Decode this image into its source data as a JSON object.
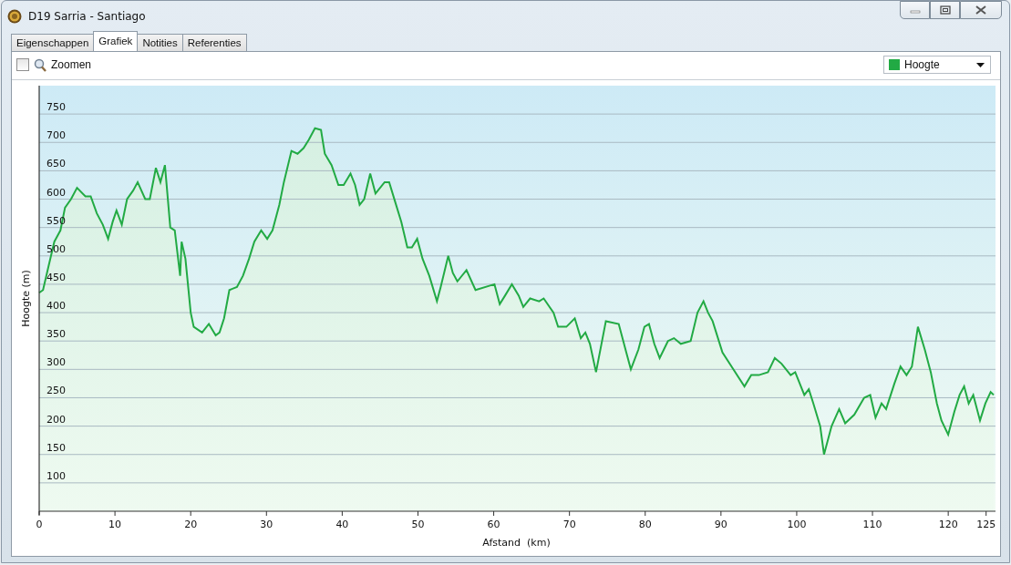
{
  "window": {
    "title": "D19 Sarria - Santiago"
  },
  "tabs": [
    {
      "label": "Eigenschappen",
      "selected": false
    },
    {
      "label": "Grafiek",
      "selected": true
    },
    {
      "label": "Notities",
      "selected": false
    },
    {
      "label": "Referenties",
      "selected": false
    }
  ],
  "toolbar": {
    "zoom_checkbox": {
      "label": "Zoomen",
      "checked": false
    }
  },
  "chart_data": {
    "type": "area",
    "xlabel": "Afstand  (km)",
    "ylabel": "Hoogte (m)",
    "x": [
      0,
      0.5,
      1.2,
      2.0,
      2.8,
      3.4,
      4.2,
      5.0,
      6.1,
      6.8,
      7.6,
      8.4,
      9.1,
      9.7,
      10.2,
      10.9,
      11.6,
      12.4,
      13.0,
      14.0,
      14.6,
      15.4,
      16.0,
      16.6,
      17.3,
      17.9,
      18.6,
      18.8,
      19.3,
      20.0,
      20.4,
      21.5,
      22.4,
      23.3,
      23.8,
      24.4,
      25.1,
      26.1,
      26.9,
      27.7,
      28.4,
      29.3,
      30.1,
      30.8,
      31.7,
      32.3,
      33.3,
      34.1,
      34.9,
      35.6,
      36.4,
      37.2,
      37.7,
      38.6,
      39.5,
      40.2,
      41.1,
      41.7,
      42.3,
      42.9,
      43.7,
      44.4,
      45.6,
      46.2,
      47.0,
      47.8,
      48.6,
      49.2,
      49.9,
      50.6,
      51.5,
      52.5,
      53.0,
      54.0,
      54.6,
      55.2,
      56.4,
      57.6,
      60.1,
      60.8,
      61.5,
      62.4,
      63.3,
      63.9,
      64.8,
      66.0,
      66.6,
      67.9,
      68.5,
      69.6,
      70.7,
      71.5,
      72.1,
      72.7,
      73.5,
      74.8,
      76.5,
      77.5,
      78.1,
      79.1,
      79.9,
      80.5,
      81.2,
      81.9,
      83.0,
      83.8,
      84.7,
      86.0,
      86.9,
      87.7,
      88.3,
      88.9,
      90.2,
      91.4,
      93.1,
      94.0,
      95.0,
      96.2,
      97.1,
      98.0,
      99.2,
      99.8,
      101.0,
      101.6,
      102.2,
      103.1,
      103.6,
      104.6,
      105.6,
      106.4,
      107.6,
      108.9,
      109.7,
      110.4,
      111.2,
      111.8,
      112.9,
      113.7,
      114.5,
      115.2,
      116.0,
      116.9,
      117.7,
      118.5,
      119.1,
      120.0,
      120.8,
      121.5,
      122.1,
      122.7,
      123.3,
      124.2,
      124.9,
      125.6,
      126.0
    ],
    "series": [
      {
        "name": "Hoogte",
        "color": "#22aa44",
        "values": [
          435,
          440,
          480,
          525,
          545,
          585,
          600,
          620,
          605,
          605,
          575,
          555,
          530,
          560,
          580,
          555,
          600,
          615,
          630,
          600,
          600,
          655,
          630,
          660,
          550,
          545,
          465,
          525,
          495,
          400,
          375,
          365,
          380,
          360,
          365,
          390,
          440,
          445,
          465,
          495,
          525,
          545,
          530,
          545,
          590,
          630,
          685,
          680,
          690,
          705,
          725,
          722,
          680,
          660,
          625,
          625,
          645,
          625,
          590,
          600,
          645,
          610,
          630,
          630,
          595,
          560,
          515,
          515,
          530,
          495,
          465,
          420,
          445,
          500,
          470,
          455,
          475,
          440,
          450,
          415,
          430,
          450,
          430,
          410,
          425,
          420,
          425,
          400,
          375,
          375,
          390,
          355,
          365,
          345,
          295,
          385,
          380,
          330,
          300,
          335,
          375,
          380,
          345,
          320,
          350,
          355,
          345,
          350,
          400,
          420,
          400,
          385,
          330,
          305,
          270,
          290,
          290,
          295,
          320,
          310,
          290,
          295,
          255,
          265,
          240,
          200,
          150,
          200,
          230,
          205,
          220,
          250,
          255,
          215,
          240,
          230,
          275,
          305,
          290,
          305,
          375,
          335,
          295,
          240,
          210,
          185,
          225,
          255,
          270,
          240,
          255,
          210,
          240,
          260,
          255
        ]
      }
    ],
    "xlim": [
      0,
      126
    ],
    "ylim": [
      50,
      800
    ],
    "grid": true,
    "xticks": [
      0,
      10,
      20,
      30,
      40,
      50,
      60,
      70,
      80,
      90,
      100,
      110,
      120,
      125
    ],
    "yticks": [
      100,
      150,
      200,
      250,
      300,
      350,
      400,
      450,
      500,
      550,
      600,
      650,
      700,
      750
    ]
  }
}
